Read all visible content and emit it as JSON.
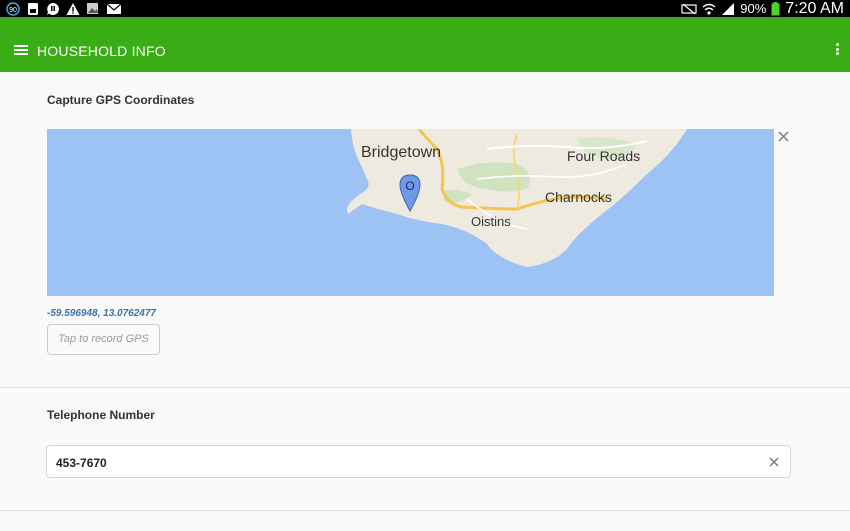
{
  "status_bar": {
    "notification_badge": "90",
    "battery": "90%",
    "time": "7:20 AM",
    "icons_left": [
      "notification-count-icon",
      "sim-icon",
      "chat-icon",
      "warning-icon",
      "image-icon",
      "mail-icon"
    ],
    "icons_right": [
      "mute-icon",
      "wifi-icon",
      "signal-icon",
      "battery-icon"
    ]
  },
  "app_bar": {
    "title": "HOUSEHOLD INFO",
    "background": "#39ac16"
  },
  "gps": {
    "label": "Capture GPS Coordinates",
    "map_labels": {
      "bridgetown": "Bridgetown",
      "four_roads": "Four Roads",
      "charnocks": "Charnocks",
      "oistins": "Oistins",
      "marker": "O"
    },
    "coordinates": "-59.596948, 13.0762477",
    "record_button": "Tap to record GPS"
  },
  "telephone": {
    "label": "Telephone Number",
    "value": "453-7670"
  }
}
